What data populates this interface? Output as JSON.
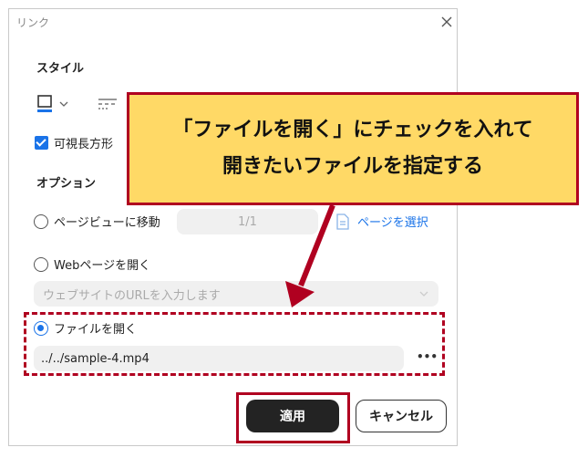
{
  "dialog": {
    "title": "リンク",
    "style_section": "スタイル",
    "visible_rect_label": "可視長方形",
    "options_section": "オプション",
    "page_view_label": "ページビューに移動",
    "page_value": "1/1",
    "select_page_label": "ページを選択",
    "web_label": "Webページを開く",
    "web_placeholder": "ウェブサイトのURLを入力します",
    "file_label": "ファイルを開く",
    "file_path": "../../sample-4.mp4",
    "more": "•••",
    "apply": "適用",
    "cancel": "キャンセル"
  },
  "callout": {
    "line1": "「ファイルを開く」にチェックを入れて",
    "line2": "開きたいファイルを指定する"
  },
  "colors": {
    "accent": "#1a73e8",
    "callout_bg": "#ffd966",
    "callout_border": "#b00020",
    "apply_bg": "#232323"
  }
}
